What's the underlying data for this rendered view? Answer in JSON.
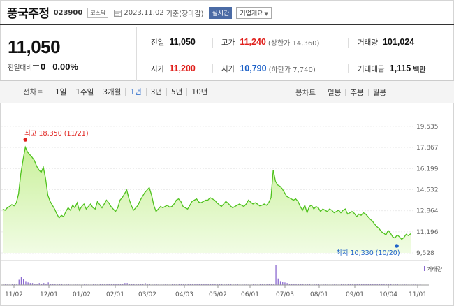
{
  "header": {
    "company_name": "풍국주정",
    "code": "023900",
    "market": "코스닥",
    "base_date": "2023.11.02",
    "base_label": "기준(장마감)",
    "realtime_label": "실시간",
    "company_info_label": "기업개요"
  },
  "summary": {
    "current_price": "11,050",
    "change_label": "전일대비",
    "change_value": "0",
    "change_pct": "0.00%",
    "prev_close_label": "전일",
    "prev_close": "11,050",
    "high_label": "고가",
    "high": "11,240",
    "upper_limit": "(상한가 14,360)",
    "volume_label": "거래량",
    "volume": "101,024",
    "open_label": "시가",
    "open": "11,200",
    "low_label": "저가",
    "low": "10,790",
    "lower_limit": "(하한가 7,740)",
    "amount_label": "거래대금",
    "amount": "1,115",
    "amount_unit": "백만"
  },
  "period_bar": {
    "line_label": "선차트",
    "periods": [
      "1일",
      "1주일",
      "3개월",
      "1년",
      "3년",
      "5년",
      "10년"
    ],
    "active_period": "1년",
    "candle_label": "봉차트",
    "candles": [
      "일봉",
      "주봉",
      "월봉"
    ]
  },
  "colors": {
    "line": "#4fc21d",
    "fill_top": "#c9f09a",
    "fill_bottom": "#f1fce4",
    "high": "#e0201c",
    "low": "#1e62c8",
    "volume": "#8b6ad0"
  },
  "chart_data": {
    "type": "area",
    "ylim": [
      9528,
      19535
    ],
    "yticks": [
      "19,535",
      "17,867",
      "16,199",
      "14,532",
      "12,864",
      "11,196",
      "9,528"
    ],
    "xticks": [
      "11/02",
      "12/01",
      "01/02",
      "02/01",
      "03/02",
      "04/03",
      "05/02",
      "06/01",
      "07/03",
      "08/01",
      "09/01",
      "10/04",
      "11/01"
    ],
    "high_annotation": "최고 18,350 (11/21)",
    "low_annotation": "최저 10,330 (10/20)",
    "volume_legend": "거래량",
    "values": [
      13000,
      12900,
      13100,
      13200,
      13350,
      13250,
      13500,
      14200,
      15800,
      16900,
      17900,
      17500,
      17300,
      17100,
      16850,
      16400,
      16100,
      15900,
      16300,
      15400,
      14100,
      13600,
      13300,
      13000,
      12600,
      12300,
      12500,
      12400,
      12800,
      13100,
      12900,
      13300,
      13100,
      13500,
      12900,
      13200,
      13400,
      13000,
      13200,
      13400,
      13100,
      13000,
      13600,
      13350,
      13100,
      13400,
      13700,
      13500,
      13200,
      13000,
      12800,
      13100,
      13700,
      13900,
      14200,
      14500,
      13800,
      13300,
      12900,
      13100,
      13300,
      13700,
      14000,
      14300,
      14500,
      14700,
      14100,
      13300,
      12800,
      13000,
      13200,
      13100,
      13200,
      13300,
      13150,
      13200,
      13400,
      13700,
      13800,
      13600,
      13200,
      13100,
      13000,
      13300,
      13600,
      13700,
      13800,
      13550,
      13500,
      13600,
      13700,
      13700,
      13900,
      13800,
      13700,
      13500,
      13350,
      13200,
      13400,
      13600,
      13450,
      13250,
      13100,
      13200,
      13300,
      13400,
      13300,
      13200,
      13400,
      13700,
      13550,
      13400,
      13500,
      13400,
      13250,
      13300,
      13400,
      13300,
      13500,
      13900,
      16100,
      15200,
      14900,
      14800,
      14600,
      14300,
      14000,
      13900,
      13800,
      13700,
      13800,
      13600,
      13200,
      12900,
      13300,
      12700,
      13200,
      13300,
      13000,
      13200,
      13100,
      12800,
      13000,
      12900,
      12800,
      13000,
      12900,
      12700,
      12800,
      12900,
      12700,
      12900,
      13000,
      12600,
      12700,
      12800,
      12650,
      12400,
      12600,
      12500,
      12700,
      12600,
      12400,
      12200,
      12050,
      11800,
      11600,
      11450,
      11200,
      11100,
      10950,
      11300,
      11100,
      10800,
      10700,
      10950,
      10800,
      10600,
      10750,
      11000,
      10900,
      11050
    ],
    "volume": [
      2,
      1,
      1,
      2,
      1,
      1,
      2,
      8,
      12,
      9,
      6,
      4,
      3,
      3,
      2,
      2,
      3,
      2,
      3,
      2,
      4,
      2,
      2,
      1,
      1,
      1,
      1,
      1,
      1,
      2,
      1,
      1,
      1,
      1,
      1,
      1,
      1,
      1,
      1,
      1,
      1,
      1,
      2,
      1,
      1,
      1,
      1,
      1,
      1,
      1,
      1,
      1,
      2,
      2,
      3,
      3,
      2,
      1,
      1,
      1,
      1,
      2,
      2,
      3,
      2,
      2,
      2,
      1,
      1,
      1,
      1,
      1,
      1,
      1,
      1,
      1,
      1,
      1,
      1,
      1,
      1,
      1,
      1,
      1,
      1,
      1,
      1,
      1,
      1,
      1,
      1,
      1,
      1,
      1,
      1,
      1,
      1,
      1,
      1,
      1,
      1,
      1,
      1,
      1,
      1,
      1,
      1,
      1,
      1,
      1,
      1,
      1,
      1,
      1,
      1,
      1,
      1,
      1,
      1,
      1,
      2,
      30,
      10,
      6,
      5,
      4,
      3,
      2,
      2,
      1,
      1,
      1,
      1,
      1,
      1,
      1,
      1,
      1,
      1,
      1,
      1,
      1,
      1,
      1,
      1,
      1,
      1,
      1,
      1,
      1,
      1,
      1,
      1,
      1,
      1,
      1,
      1,
      1,
      1,
      1,
      1,
      1,
      1,
      1,
      1,
      1,
      1,
      1,
      1,
      1,
      1,
      1,
      1,
      1,
      1,
      1,
      1,
      1,
      1,
      1,
      1,
      1,
      1,
      1,
      2,
      1
    ]
  }
}
